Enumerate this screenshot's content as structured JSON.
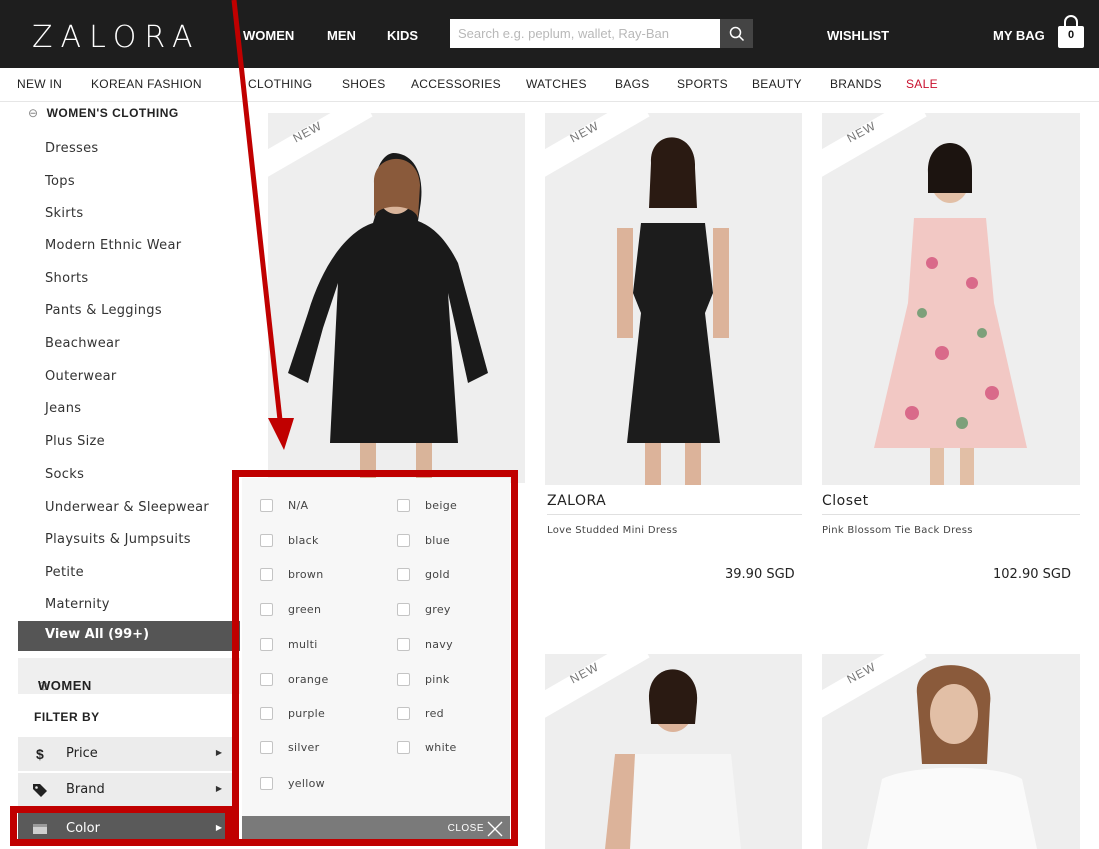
{
  "header": {
    "logo": "ZALORA",
    "nav": [
      "WOMEN",
      "MEN",
      "KIDS"
    ],
    "search_placeholder": "Search e.g. peplum, wallet, Ray-Ban",
    "wishlist": "WISHLIST",
    "mybag": "MY BAG",
    "bag_count": "0"
  },
  "subnav": [
    "NEW IN",
    "KOREAN FASHION",
    "CLOTHING",
    "SHOES",
    "ACCESSORIES",
    "WATCHES",
    "BAGS",
    "SPORTS",
    "BEAUTY",
    "BRANDS",
    "SALE"
  ],
  "sidebar": {
    "section_title": "WOMEN'S CLOTHING",
    "section_symbol": "⊖",
    "items": [
      "Dresses",
      "Tops",
      "Skirts",
      "Modern Ethnic Wear",
      "Shorts",
      "Pants & Leggings",
      "Beachwear",
      "Outerwear",
      "Jeans",
      "Plus Size",
      "Socks",
      "Underwear & Sleepwear",
      "Playsuits & Jumpsuits",
      "Petite",
      "Maternity"
    ],
    "view_all": "View All (99+)",
    "women_symbol": "⊕",
    "women_label": "WOMEN",
    "filter_by": "FILTER BY",
    "filters": [
      {
        "label": "Price",
        "icon": "dollar-icon"
      },
      {
        "label": "Brand",
        "icon": "tag-icon"
      },
      {
        "label": "Color",
        "icon": "color-swatch-icon"
      }
    ]
  },
  "color_popup": {
    "options": [
      "N/A",
      "beige",
      "black",
      "blue",
      "brown",
      "gold",
      "green",
      "grey",
      "multi",
      "navy",
      "orange",
      "pink",
      "purple",
      "red",
      "silver",
      "white",
      "yellow"
    ],
    "close_label": "CLOSE"
  },
  "products": [
    {
      "badge": "NEW",
      "brand": "",
      "name": "",
      "price": ""
    },
    {
      "badge": "NEW",
      "brand": "ZALORA",
      "name": "Love Studded Mini Dress",
      "price": "39.90 SGD"
    },
    {
      "badge": "NEW",
      "brand": "Closet",
      "name": "Pink Blossom Tie Back Dress",
      "price": "102.90 SGD"
    },
    {
      "badge": "NEW",
      "brand": "",
      "name": "",
      "price": ""
    },
    {
      "badge": "NEW",
      "brand": "",
      "name": "",
      "price": ""
    }
  ],
  "partial_price_glyph": ")",
  "colors": {
    "header_bg": "#1e1e1e",
    "sale": "#c8102e",
    "highlight": "#c00000"
  }
}
